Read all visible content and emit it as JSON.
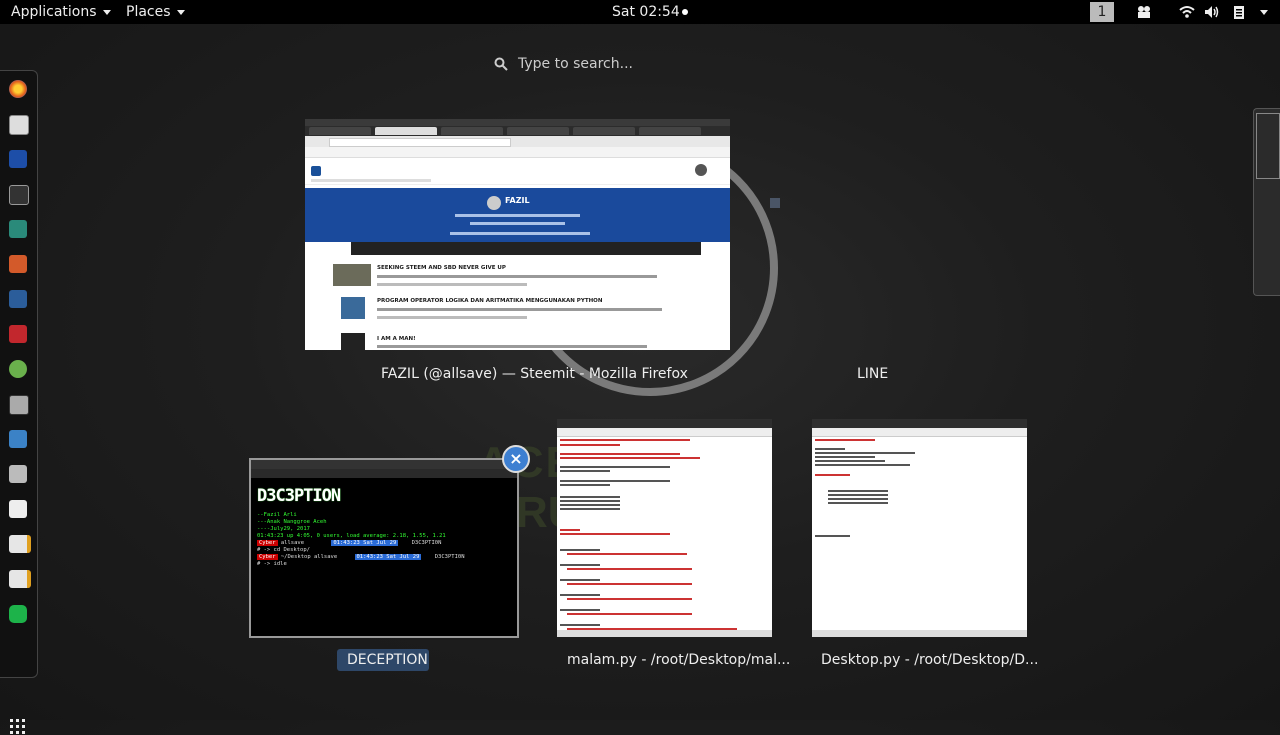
{
  "topbar": {
    "applications": "Applications",
    "places": "Places",
    "clock": "Sat 02:54",
    "workspace": "1"
  },
  "search": {
    "placeholder": "Type to search..."
  },
  "windows": {
    "firefox": {
      "caption": "FAZIL (@allsave) — Steemit - Mozilla Firefox",
      "profile_name": "FAZIL",
      "posts": [
        "SEEKING STEEM AND SBD NEVER GIVE UP",
        "PROGRAM OPERATOR LOGIKA DAN ARITMATIKA MENGGUNAKAN PYTHON",
        "I AM A MAN!"
      ]
    },
    "line": {
      "caption": "LINE"
    },
    "terminal": {
      "caption": "DECEPTION",
      "banner": "D3C3PTION",
      "lines": [
        "--Fazil Arli",
        "---Anak Nanggroe Aceh",
        "----July29, 2017",
        "01:43:23 up  4:05,  0 users,  load average: 2.18, 1.55, 1.21"
      ],
      "prompt1_user": "Cyber",
      "prompt1_host": "allsave",
      "prompt1_time": "01:43:23 Sat Jul 29",
      "prompt1_tag": "D3C3PTI0N",
      "cmd1": "# -> cd Desktop/",
      "prompt2_user": "Cyber",
      "prompt2_path": "~/Desktop",
      "prompt2_host": "allsave",
      "prompt2_time": "01:43:23 Sat Jul 29",
      "prompt2_tag": "D3C3PTI0N",
      "cmd2": "# -> idle"
    },
    "malam": {
      "caption": "malam.py - /root/Desktop/mal..."
    },
    "desktop_py": {
      "caption": "Desktop.py - /root/Desktop/D..."
    }
  },
  "background_logo": {
    "line1": "ACEH CODE",
    "line2": "RU"
  }
}
